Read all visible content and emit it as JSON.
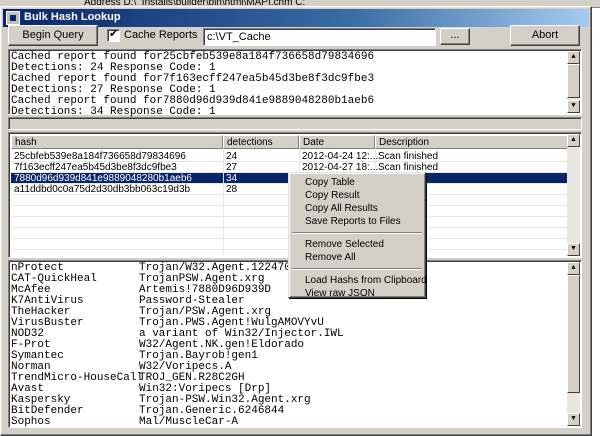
{
  "background": {
    "address_text": "Address  D:\\_Installs\\builder\\bin\\html\\MAPI.chm  C:"
  },
  "window": {
    "title": "Bulk Hash Lookup"
  },
  "toolbar": {
    "begin_label": "Begin Query",
    "cache_label": "Cache Reports",
    "cache_checked": true,
    "cache_path": "c:\\VT_Cache",
    "browse_label": "...",
    "abort_label": "Abort"
  },
  "log": {
    "lines": [
      "Cached report found for25cbfeb539e8a184f736658d79834696",
      "Detections: 24 Response Code: 1",
      "Cached report found for7f163ecff247ea5b45d3be8f3dc9fbe3",
      "Detections: 27 Response Code: 1",
      "Cached report found for7880d96d939d841e9889048280b1aeb6",
      "Detections: 34 Response Code: 1"
    ]
  },
  "list": {
    "columns": [
      "hash",
      "detections",
      "Date",
      "Description"
    ],
    "rows": [
      {
        "hash": "25cbfeb539e8a184f736658d79834696",
        "detections": "24",
        "date": "2012-04-24 12:...",
        "description": "Scan finished"
      },
      {
        "hash": "7f163ecff247ea5b45d3be8f3dc9fbe3",
        "detections": "27",
        "date": "2012-04-27 18:...",
        "description": "Scan finished"
      },
      {
        "hash": "7880d96d939d841e9889048280b1aeb6",
        "detections": "34",
        "date": "",
        "description": ""
      },
      {
        "hash": "a11ddbd0c0a75d2d30db3bb063c19d3b",
        "detections": "28",
        "date": "",
        "description": ""
      }
    ],
    "selected_index": 2
  },
  "context_menu": {
    "groups": [
      [
        "Copy Table",
        "Copy Result",
        "Copy All Results",
        "Save Reports to Files"
      ],
      [
        "Remove Selected",
        "Remove All"
      ],
      [
        "Load Hashs from Clipboard",
        "View raw JSON"
      ]
    ]
  },
  "results": {
    "lines": [
      [
        "nProtect",
        "Trojan/W32.Agent.1224704"
      ],
      [
        "CAT-QuickHeal",
        "TrojanPSW.Agent.xrg"
      ],
      [
        "McAfee",
        "Artemis!7880D96D939D"
      ],
      [
        "K7AntiVirus",
        "Password-Stealer"
      ],
      [
        "TheHacker",
        "Trojan/PSW.Agent.xrg"
      ],
      [
        "VirusBuster",
        "Trojan.PWS.Agent!WulgAMOVYvU"
      ],
      [
        "NOD32",
        "a variant of Win32/Injector.IWL"
      ],
      [
        "F-Prot",
        "W32/Agent.NK.gen!Eldorado"
      ],
      [
        "Symantec",
        "Trojan.Bayrob!gen1"
      ],
      [
        "Norman",
        "W32/Voripecs.A"
      ],
      [
        "TrendMicro-HouseCall",
        "TROJ_GEN.R28C2GH"
      ],
      [
        "Avast",
        "Win32:Voripecs [Drp]"
      ],
      [
        "Kaspersky",
        "Trojan-PSW.Win32.Agent.xrg"
      ],
      [
        "BitDefender",
        "Trojan.Generic.6246844"
      ],
      [
        "Sophos",
        "Mal/MuscleCar-A"
      ]
    ]
  },
  "colors": {
    "selection": "#0a246a",
    "titlebar": "#0a246a",
    "face": "#d4d0c8"
  },
  "icons": [
    "app-icon",
    "checkbox-check-icon",
    "scroll-up-arrow-icon",
    "scroll-down-arrow-icon"
  ]
}
